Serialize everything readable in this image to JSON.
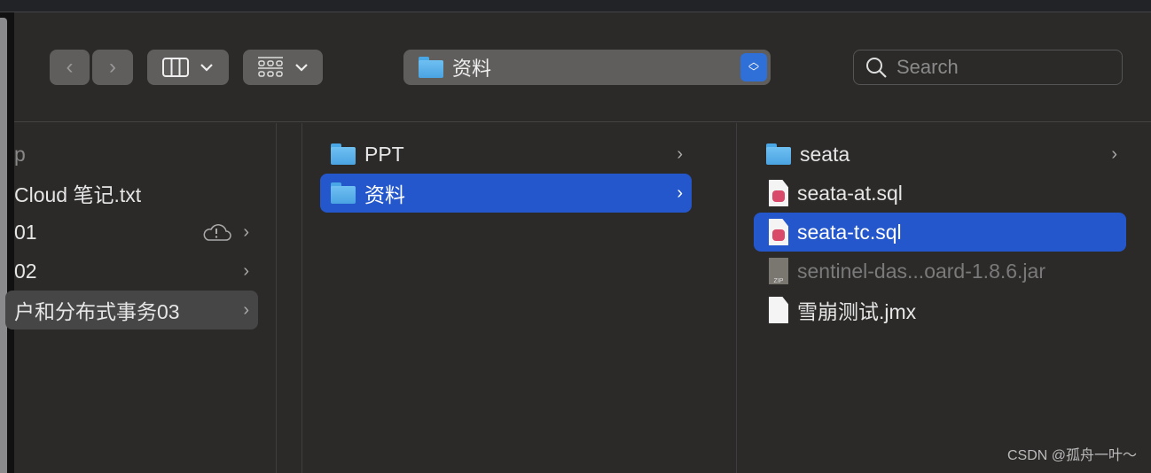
{
  "toolbar": {
    "path_label": "资料",
    "search_placeholder": "Search"
  },
  "col1": {
    "items": [
      {
        "name": "p",
        "chevron": false,
        "cloud": false,
        "dim": true
      },
      {
        "name": "Cloud 笔记.txt",
        "chevron": false,
        "cloud": false
      },
      {
        "name": "01",
        "chevron": true,
        "cloud": true
      },
      {
        "name": "02",
        "chevron": true,
        "cloud": false
      },
      {
        "name": "户和分布式事务03",
        "chevron": true,
        "cloud": false,
        "selected_inactive": true
      }
    ]
  },
  "col2": {
    "items": [
      {
        "name": "PPT",
        "icon": "folder"
      },
      {
        "name": "资料",
        "icon": "folder",
        "selected": true
      }
    ]
  },
  "col3": {
    "items": [
      {
        "name": "seata",
        "icon": "folder"
      },
      {
        "name": "seata-at.sql",
        "icon": "sql"
      },
      {
        "name": "seata-tc.sql",
        "icon": "sql",
        "selected": true
      },
      {
        "name": "sentinel-das...oard-1.8.6.jar",
        "icon": "zip",
        "dim": true
      },
      {
        "name": "雪崩测试.jmx",
        "icon": "document"
      }
    ]
  },
  "colors": {
    "selection": "#2457cc",
    "folder": "#5ab3ec",
    "stepper": "#2f6fd8"
  },
  "watermark": "CSDN @孤舟一叶～"
}
